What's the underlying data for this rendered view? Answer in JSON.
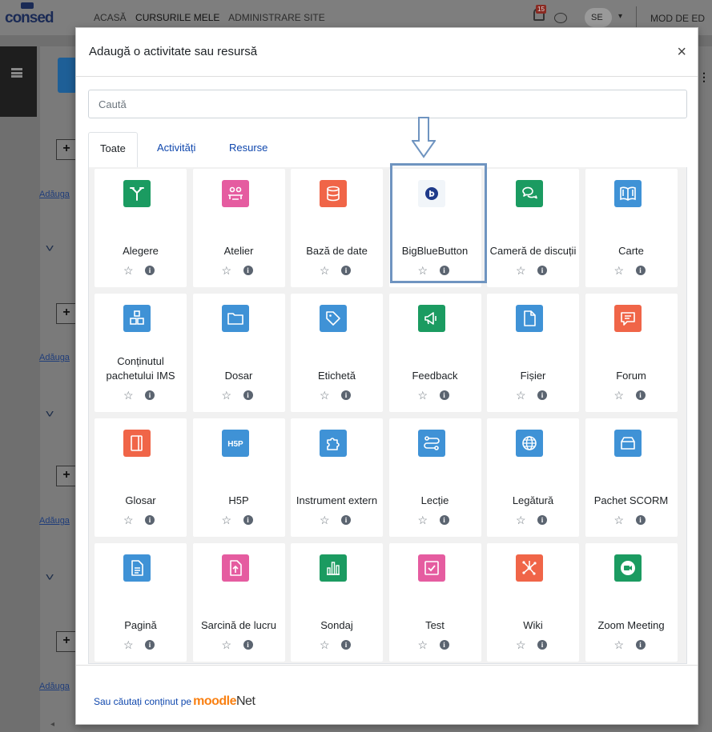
{
  "app": {
    "logo": "consed",
    "nav": [
      "ACASĂ",
      "CURSURILE MELE",
      "ADMINISTRARE SITE"
    ],
    "notifications_count": "15",
    "user_initials": "SE",
    "edit_mode_label": "MOD DE ED"
  },
  "background": {
    "add_label": "Adăuga",
    "section_label": "S"
  },
  "modal": {
    "title": "Adaugă o activitate sau resursă",
    "close": "×",
    "search_placeholder": "Caută",
    "tabs": [
      "Toate",
      "Activități",
      "Resurse"
    ],
    "footer_text": "Sau căutați conținut pe",
    "moodlenet_brand": "moodle",
    "moodlenet_suffix": "Net"
  },
  "items": [
    {
      "label": "Alegere",
      "color": "#1b9b61",
      "icon": "choice-icon"
    },
    {
      "label": "Atelier",
      "color": "#e55ca0",
      "icon": "workshop-icon"
    },
    {
      "label": "Bază de date",
      "color": "#f06548",
      "icon": "database-icon"
    },
    {
      "label": "BigBlueButton",
      "color": "#f1f5f9",
      "icon": "bigbluebutton-icon"
    },
    {
      "label": "Cameră de discuții",
      "color": "#1b9b61",
      "icon": "chat-icon"
    },
    {
      "label": "Carte",
      "color": "#3f92d6",
      "icon": "book-icon"
    },
    {
      "label": "Conținutul pachetului IMS",
      "color": "#3f92d6",
      "icon": "ims-package-icon"
    },
    {
      "label": "Dosar",
      "color": "#3f92d6",
      "icon": "folder-icon"
    },
    {
      "label": "Etichetă",
      "color": "#3f92d6",
      "icon": "label-icon"
    },
    {
      "label": "Feedback",
      "color": "#1b9b61",
      "icon": "feedback-icon"
    },
    {
      "label": "Fișier",
      "color": "#3f92d6",
      "icon": "file-icon"
    },
    {
      "label": "Forum",
      "color": "#f06548",
      "icon": "forum-icon"
    },
    {
      "label": "Glosar",
      "color": "#f06548",
      "icon": "glossary-icon"
    },
    {
      "label": "H5P",
      "color": "#3f92d6",
      "icon": "h5p-icon"
    },
    {
      "label": "Instrument extern",
      "color": "#3f92d6",
      "icon": "external-tool-icon"
    },
    {
      "label": "Lecție",
      "color": "#3f92d6",
      "icon": "lesson-icon"
    },
    {
      "label": "Legătură",
      "color": "#3f92d6",
      "icon": "url-icon"
    },
    {
      "label": "Pachet SCORM",
      "color": "#3f92d6",
      "icon": "scorm-icon"
    },
    {
      "label": "Pagină",
      "color": "#3f92d6",
      "icon": "page-icon"
    },
    {
      "label": "Sarcină de lucru",
      "color": "#e55ca0",
      "icon": "assignment-icon"
    },
    {
      "label": "Sondaj",
      "color": "#1b9b61",
      "icon": "survey-icon"
    },
    {
      "label": "Test",
      "color": "#e55ca0",
      "icon": "quiz-icon"
    },
    {
      "label": "Wiki",
      "color": "#f06548",
      "icon": "wiki-icon"
    },
    {
      "label": "Zoom Meeting",
      "color": "#1b9b61",
      "icon": "zoom-icon"
    }
  ]
}
